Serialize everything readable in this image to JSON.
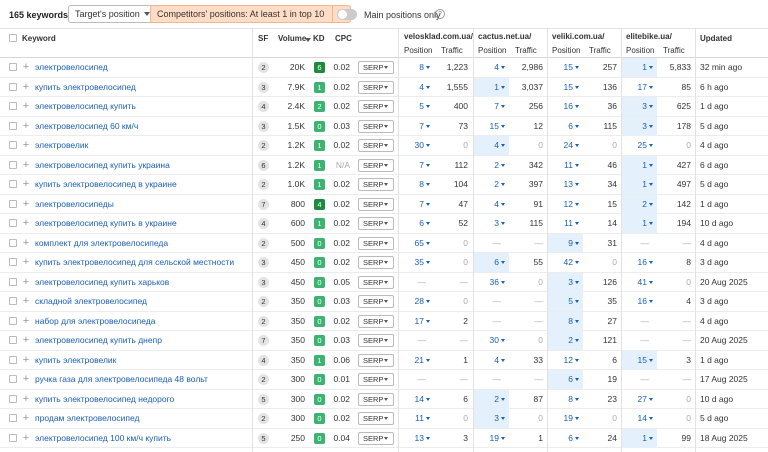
{
  "toolbar": {
    "keyword_count": "165 keywords",
    "target_filter": "Target's position",
    "competitor_filter": "Competitors' positions: At least 1 in top 10",
    "close_glyph": "✕",
    "main_positions_label": "Main positions only",
    "help_glyph": "?"
  },
  "colors": {
    "kd_green": "#3cb371",
    "kd_dark_green": "#1e8a3e",
    "highlight": "#e4f1fd",
    "link": "#1a5fb4"
  },
  "header": {
    "keyword": "Keyword",
    "sf": "SF",
    "volume": "Volume",
    "kd": "KD",
    "cpc": "CPC",
    "position": "Position",
    "traffic": "Traffic",
    "updated": "Updated",
    "competitors": [
      "velosklad.com.ua/",
      "cactus.net.ua/",
      "veliki.com.ua/",
      "elitebike.ua/"
    ]
  },
  "rows": [
    {
      "kw": "электровелосипед",
      "sf": "2",
      "vol": "20K",
      "kd": "6",
      "cpc": "0.02",
      "serp": "SERP",
      "c": [
        [
          "8",
          "1,223"
        ],
        [
          "4",
          "2,986"
        ],
        [
          "15",
          "257"
        ],
        [
          "1",
          "5,833"
        ]
      ],
      "upd": "32 min ago",
      "hl": 3
    },
    {
      "kw": "купить электровелосипед",
      "sf": "3",
      "vol": "7.9K",
      "kd": "1",
      "cpc": "0.02",
      "serp": "SERP",
      "c": [
        [
          "4",
          "1,555"
        ],
        [
          "1",
          "3,037"
        ],
        [
          "15",
          "136"
        ],
        [
          "17",
          "85"
        ]
      ],
      "upd": "6 h ago",
      "hl": 1
    },
    {
      "kw": "электровелосипед купить",
      "sf": "4",
      "vol": "2.4K",
      "kd": "2",
      "cpc": "0.02",
      "serp": "SERP",
      "c": [
        [
          "5",
          "400"
        ],
        [
          "7",
          "256"
        ],
        [
          "16",
          "36"
        ],
        [
          "3",
          "625"
        ]
      ],
      "upd": "1 d ago",
      "hl": 3
    },
    {
      "kw": "электровелосипед 60 км/ч",
      "sf": "3",
      "vol": "1.5K",
      "kd": "0",
      "cpc": "0.03",
      "serp": "SERP",
      "c": [
        [
          "7",
          "73"
        ],
        [
          "15",
          "12"
        ],
        [
          "6",
          "115"
        ],
        [
          "3",
          "178"
        ]
      ],
      "upd": "5 d ago",
      "hl": 3
    },
    {
      "kw": "электровелик",
      "sf": "2",
      "vol": "1.2K",
      "kd": "1",
      "cpc": "0.02",
      "serp": "SERP",
      "c": [
        [
          "30",
          "0"
        ],
        [
          "4",
          "0"
        ],
        [
          "24",
          "0"
        ],
        [
          "25",
          "0"
        ]
      ],
      "upd": "4 d ago",
      "hl": 1
    },
    {
      "kw": "электровелосипед купить украина",
      "sf": "6",
      "vol": "1.2K",
      "kd": "1",
      "cpc": "N/A",
      "serp": "SERP",
      "c": [
        [
          "7",
          "112"
        ],
        [
          "2",
          "342"
        ],
        [
          "11",
          "46"
        ],
        [
          "1",
          "427"
        ]
      ],
      "upd": "6 d ago",
      "hl": 3
    },
    {
      "kw": "купить электровелосипед в украине",
      "sf": "2",
      "vol": "1.0K",
      "kd": "1",
      "cpc": "0.02",
      "serp": "SERP",
      "c": [
        [
          "8",
          "104"
        ],
        [
          "2",
          "397"
        ],
        [
          "13",
          "34"
        ],
        [
          "1",
          "497"
        ]
      ],
      "upd": "5 d ago",
      "hl": 3
    },
    {
      "kw": "электровелосипеды",
      "sf": "7",
      "vol": "800",
      "kd": "4",
      "cpc": "0.02",
      "serp": "SERP",
      "c": [
        [
          "7",
          "47"
        ],
        [
          "4",
          "91"
        ],
        [
          "12",
          "15"
        ],
        [
          "2",
          "142"
        ]
      ],
      "upd": "1 d ago",
      "hl": 3
    },
    {
      "kw": "электровелосипед купить в украине",
      "sf": "4",
      "vol": "600",
      "kd": "1",
      "cpc": "0.02",
      "serp": "SERP",
      "c": [
        [
          "6",
          "52"
        ],
        [
          "3",
          "115"
        ],
        [
          "11",
          "14"
        ],
        [
          "1",
          "194"
        ]
      ],
      "upd": "10 d ago",
      "hl": 3
    },
    {
      "kw": "комплект для электровелосипеда",
      "sf": "2",
      "vol": "500",
      "kd": "0",
      "cpc": "0.02",
      "serp": "SERP",
      "c": [
        [
          "65",
          "0"
        ],
        [
          "—",
          "—"
        ],
        [
          "9",
          "31"
        ],
        [
          "—",
          "—"
        ]
      ],
      "upd": "4 d ago",
      "hl": 2
    },
    {
      "kw": "купить электровелосипед для сельской местности",
      "sf": "3",
      "vol": "450",
      "kd": "0",
      "cpc": "0.02",
      "serp": "SERP",
      "c": [
        [
          "35",
          "0"
        ],
        [
          "6",
          "55"
        ],
        [
          "42",
          "0"
        ],
        [
          "16",
          "8"
        ]
      ],
      "upd": "3 d ago",
      "hl": 1
    },
    {
      "kw": "электровелосипед купить харьков",
      "sf": "3",
      "vol": "450",
      "kd": "0",
      "cpc": "0.05",
      "serp": "SERP",
      "c": [
        [
          "—",
          "—"
        ],
        [
          "36",
          "0"
        ],
        [
          "3",
          "126"
        ],
        [
          "41",
          "0"
        ]
      ],
      "upd": "20 Aug 2025",
      "hl": 2
    },
    {
      "kw": "складной электровелосипед",
      "sf": "2",
      "vol": "350",
      "kd": "0",
      "cpc": "0.03",
      "serp": "SERP",
      "c": [
        [
          "28",
          "0"
        ],
        [
          "—",
          "—"
        ],
        [
          "5",
          "35"
        ],
        [
          "16",
          "4"
        ]
      ],
      "upd": "3 d ago",
      "hl": 2
    },
    {
      "kw": "набор для электровелосипеда",
      "sf": "2",
      "vol": "350",
      "kd": "0",
      "cpc": "0.02",
      "serp": "SERP",
      "c": [
        [
          "17",
          "2"
        ],
        [
          "—",
          "—"
        ],
        [
          "8",
          "27"
        ],
        [
          "—",
          "—"
        ]
      ],
      "upd": "4 d ago",
      "hl": 2
    },
    {
      "kw": "электровелосипед купить днепр",
      "sf": "7",
      "vol": "350",
      "kd": "0",
      "cpc": "0.03",
      "serp": "SERP",
      "c": [
        [
          "—",
          "—"
        ],
        [
          "30",
          "0"
        ],
        [
          "2",
          "121"
        ],
        [
          "—",
          "—"
        ]
      ],
      "upd": "20 Aug 2025",
      "hl": 2
    },
    {
      "kw": "купить электровелик",
      "sf": "4",
      "vol": "350",
      "kd": "1",
      "cpc": "0.06",
      "serp": "SERP",
      "c": [
        [
          "21",
          "1"
        ],
        [
          "4",
          "33"
        ],
        [
          "12",
          "6"
        ],
        [
          "15",
          "3"
        ]
      ],
      "upd": "1 d ago",
      "hl": 3
    },
    {
      "kw": "ручка газа для электровелосипеда 48 вольт",
      "sf": "2",
      "vol": "300",
      "kd": "0",
      "cpc": "0.01",
      "serp": "SERP",
      "c": [
        [
          "—",
          "—"
        ],
        [
          "—",
          "—"
        ],
        [
          "6",
          "19"
        ],
        [
          "—",
          "—"
        ]
      ],
      "upd": "17 Aug 2025",
      "hl": 2
    },
    {
      "kw": "купить электровелосипед недорого",
      "sf": "5",
      "vol": "300",
      "kd": "0",
      "cpc": "0.02",
      "serp": "SERP",
      "c": [
        [
          "14",
          "6"
        ],
        [
          "2",
          "87"
        ],
        [
          "8",
          "23"
        ],
        [
          "27",
          "0"
        ]
      ],
      "upd": "10 d ago",
      "hl": 1
    },
    {
      "kw": "продам электровелосипед",
      "sf": "2",
      "vol": "300",
      "kd": "0",
      "cpc": "0.02",
      "serp": "SERP",
      "c": [
        [
          "11",
          "0"
        ],
        [
          "3",
          "0"
        ],
        [
          "19",
          "0"
        ],
        [
          "14",
          "0"
        ]
      ],
      "upd": "5 d ago",
      "hl": 1
    },
    {
      "kw": "электровелосипед 100 км/ч купить",
      "sf": "5",
      "vol": "250",
      "kd": "0",
      "cpc": "0.04",
      "serp": "SERP",
      "c": [
        [
          "13",
          "3"
        ],
        [
          "19",
          "1"
        ],
        [
          "6",
          "24"
        ],
        [
          "1",
          "99"
        ]
      ],
      "upd": "18 Aug 2025",
      "hl": 3
    }
  ]
}
